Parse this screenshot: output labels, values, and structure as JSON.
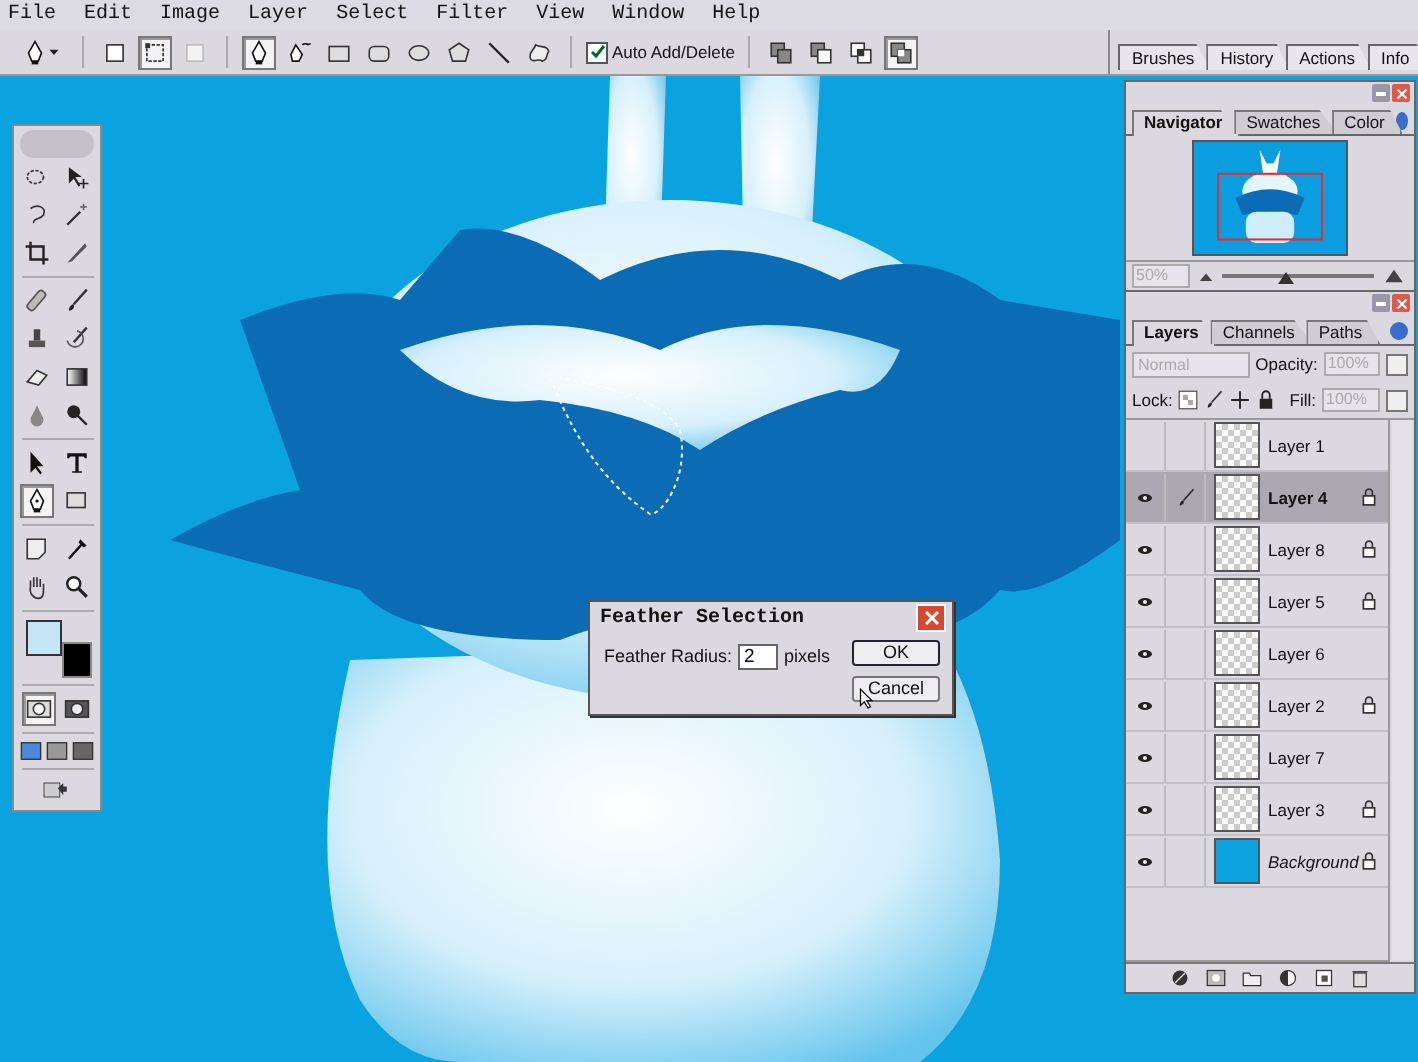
{
  "menu_bar": {
    "items": [
      "File",
      "Edit",
      "Image",
      "Layer",
      "Select",
      "Filter",
      "View",
      "Window",
      "Help"
    ]
  },
  "options_bar": {
    "modes": [
      {
        "selected": false
      },
      {
        "selected": true
      },
      {
        "selected": false
      }
    ],
    "shape_tools": [
      {
        "selected": true
      },
      {
        "selected": false
      },
      {
        "selected": false
      },
      {
        "selected": false
      },
      {
        "selected": false
      },
      {
        "selected": false
      },
      {
        "selected": false
      },
      {
        "selected": false
      }
    ],
    "auto_add_delete": {
      "label": "Auto Add/Delete",
      "checked": true
    },
    "combine_modes": [
      {
        "selected": false
      },
      {
        "selected": false
      },
      {
        "selected": false
      },
      {
        "selected": true
      }
    ]
  },
  "palette_well": {
    "tabs": [
      "Brushes",
      "History",
      "Actions",
      "Info"
    ]
  },
  "toolbox": {
    "tools": [
      {
        "selected": false
      },
      {
        "selected": false
      },
      {
        "selected": false
      },
      {
        "selected": false
      },
      {
        "selected": false
      },
      {
        "selected": false
      },
      {
        "selected": false
      },
      {
        "selected": false
      },
      {
        "selected": false
      },
      {
        "selected": false
      },
      {
        "selected": false
      },
      {
        "selected": false
      },
      {
        "selected": false
      },
      {
        "selected": false
      },
      {
        "selected": false
      },
      {
        "selected": false
      },
      {
        "selected": true
      },
      {
        "selected": false
      },
      {
        "selected": false
      },
      {
        "selected": false
      },
      {
        "selected": false
      },
      {
        "selected": false
      }
    ],
    "mask_modes": [
      {
        "selected": true
      },
      {
        "selected": false
      }
    ]
  },
  "navigator_panel": {
    "tabs": [
      {
        "label": "Navigator",
        "selected": true
      },
      {
        "label": "Swatches",
        "selected": false
      },
      {
        "label": "Color",
        "selected": false
      }
    ],
    "zoom": "50%",
    "zoom_slider": {
      "level": 0.42
    }
  },
  "layers_panel": {
    "tabs": [
      {
        "label": "Layers",
        "selected": true
      },
      {
        "label": "Channels",
        "selected": false
      },
      {
        "label": "Paths",
        "selected": false
      }
    ],
    "blend_mode": "Normal",
    "opacity_label": "Opacity:",
    "opacity": "100%",
    "lock_label": "Lock:",
    "fill_label": "Fill:",
    "fill": "100%",
    "layers": [
      {
        "name": "Layer 1",
        "kind": "layer",
        "visible": false,
        "selected": false,
        "locked": false
      },
      {
        "name": "Layer 4",
        "kind": "layer",
        "visible": true,
        "selected": true,
        "locked": true
      },
      {
        "name": "Layer 8",
        "kind": "layer",
        "visible": true,
        "selected": false,
        "locked": true
      },
      {
        "name": "Layer 5",
        "kind": "layer",
        "visible": true,
        "selected": false,
        "locked": true
      },
      {
        "name": "Layer 6",
        "kind": "layer",
        "visible": true,
        "selected": false,
        "locked": false
      },
      {
        "name": "Layer 2",
        "kind": "layer",
        "visible": true,
        "selected": false,
        "locked": true
      },
      {
        "name": "Layer 7",
        "kind": "layer",
        "visible": true,
        "selected": false,
        "locked": false
      },
      {
        "name": "Layer 3",
        "kind": "layer",
        "visible": true,
        "selected": false,
        "locked": true
      },
      {
        "name": "Background",
        "kind": "background",
        "visible": true,
        "selected": false,
        "locked": true
      }
    ]
  },
  "dialog": {
    "title": "Feather Selection",
    "label": "Feather Radius:",
    "value": "2",
    "unit": "pixels",
    "buttons": [
      {
        "label": "OK",
        "kind": "default"
      },
      {
        "label": "Cancel",
        "kind": "normal"
      }
    ]
  }
}
